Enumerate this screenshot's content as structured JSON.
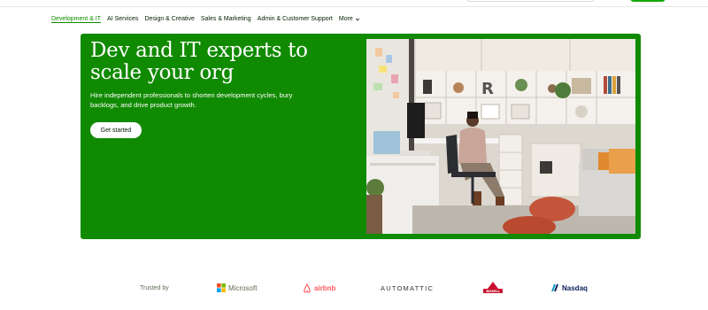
{
  "nav": {
    "categories": [
      {
        "label": "Development & IT"
      },
      {
        "label": "AI Services"
      },
      {
        "label": "Design & Creative"
      },
      {
        "label": "Sales & Marketing"
      },
      {
        "label": "Admin & Customer Support"
      }
    ],
    "more_label": "More"
  },
  "hero": {
    "title": "Dev and IT experts to scale your org",
    "subtitle": "Hire independent professionals to shorten development cycles, bury backlogs, and drive product growth.",
    "cta_label": "Get started"
  },
  "trusted": {
    "label": "Trusted by",
    "logos": {
      "microsoft": "Microsoft",
      "airbnb": "airbnb",
      "automattic": "AUTOMATTIC",
      "bissell": "BISSELL",
      "nasdaq": "Nasdaq"
    }
  },
  "colors": {
    "brand_green": "#108a00",
    "accent_green": "#14a800",
    "text_dark": "#001e00",
    "muted": "#5e6d55"
  }
}
